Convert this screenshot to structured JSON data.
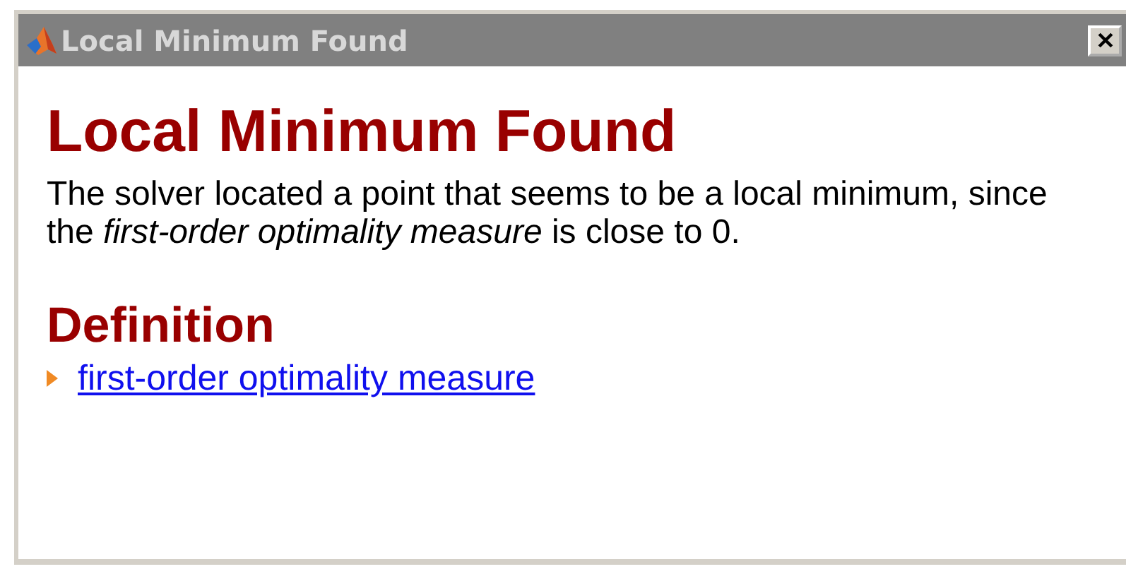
{
  "window": {
    "title": "Local Minimum Found"
  },
  "heading": "Local Minimum Found",
  "message": "The solver located a point that seems to be a local minimum, since the *first-order optimality measure* is close to 0.",
  "definition": {
    "heading": "Definition",
    "links": [
      {
        "label": "first-order optimality measure",
        "expanded": false
      }
    ]
  }
}
